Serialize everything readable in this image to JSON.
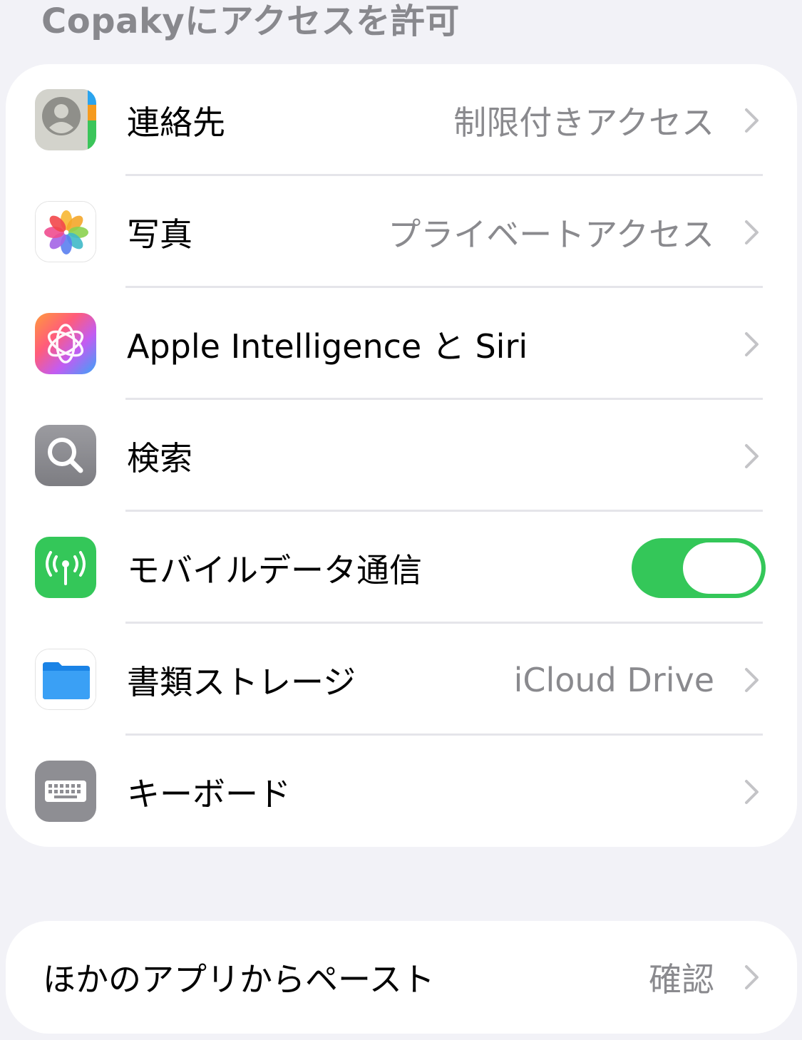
{
  "header": {
    "title": "Copakyにアクセスを許可"
  },
  "permissions": {
    "rows": [
      {
        "label": "連絡先",
        "value": "制限付きアクセス",
        "icon": "contacts-icon"
      },
      {
        "label": "写真",
        "value": "プライベートアクセス",
        "icon": "photos-icon"
      },
      {
        "label": "Apple Intelligence と Siri",
        "value": "",
        "icon": "apple-intelligence-icon"
      },
      {
        "label": "検索",
        "value": "",
        "icon": "search-icon"
      },
      {
        "label": "モバイルデータ通信",
        "value": "",
        "icon": "cellular-antenna-icon",
        "toggle_on": true
      },
      {
        "label": "書類ストレージ",
        "value": "iCloud Drive",
        "icon": "folder-icon"
      },
      {
        "label": "キーボード",
        "value": "",
        "icon": "keyboard-icon"
      }
    ]
  },
  "paste": {
    "label": "ほかのアプリからペースト",
    "value": "確認"
  },
  "colors": {
    "background": "#f2f2f7",
    "card": "#ffffff",
    "toggle_on": "#34c759",
    "secondary_text": "#8a8a8e",
    "chevron": "#c4c4c7"
  }
}
